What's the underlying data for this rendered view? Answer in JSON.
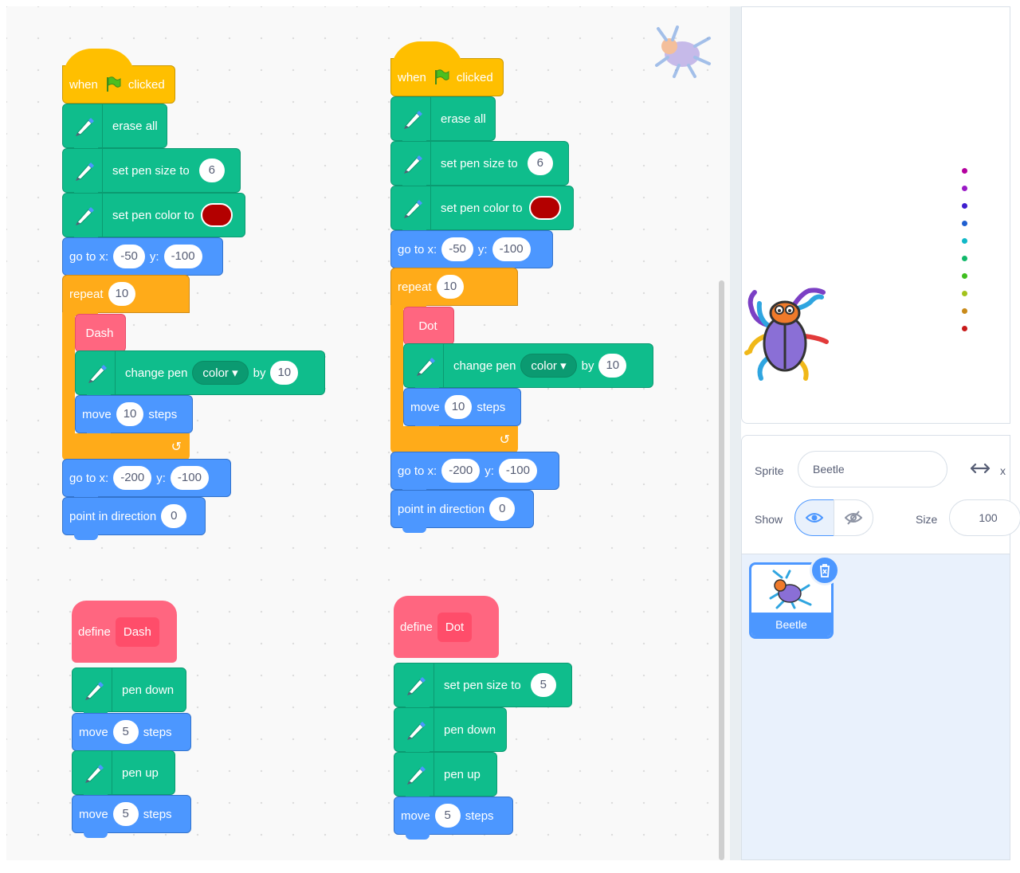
{
  "script1": {
    "hat": {
      "when": "when",
      "clicked": "clicked"
    },
    "erase": "erase all",
    "size": {
      "label": "set pen size to",
      "value": "6"
    },
    "color": {
      "label": "set pen color to"
    },
    "goto1": {
      "label": "go to x:",
      "x": "-50",
      "ylabel": "y:",
      "y": "-100"
    },
    "repeat": {
      "label": "repeat",
      "value": "10"
    },
    "call": "Dash",
    "change": {
      "label": "change pen",
      "dropdown": "color ▾",
      "by": "by",
      "value": "10"
    },
    "move": {
      "label": "move",
      "value": "10",
      "unit": "steps"
    },
    "loop_arrow": "↺",
    "goto2": {
      "label": "go to x:",
      "x": "-200",
      "ylabel": "y:",
      "y": "-100"
    },
    "point": {
      "label": "point in direction",
      "value": "0"
    }
  },
  "script2": {
    "hat": {
      "when": "when",
      "clicked": "clicked"
    },
    "erase": "erase all",
    "size": {
      "label": "set pen size to",
      "value": "6"
    },
    "color": {
      "label": "set pen color to"
    },
    "goto1": {
      "label": "go to x:",
      "x": "-50",
      "ylabel": "y:",
      "y": "-100"
    },
    "repeat": {
      "label": "repeat",
      "value": "10"
    },
    "call": "Dot",
    "change": {
      "label": "change pen",
      "dropdown": "color ▾",
      "by": "by",
      "value": "10"
    },
    "move": {
      "label": "move",
      "value": "10",
      "unit": "steps"
    },
    "loop_arrow": "↺",
    "goto2": {
      "label": "go to x:",
      "x": "-200",
      "ylabel": "y:",
      "y": "-100"
    },
    "point": {
      "label": "point in direction",
      "value": "0"
    }
  },
  "define_dash": {
    "define": "define",
    "name": "Dash",
    "pen_down": "pen down",
    "move1": {
      "label": "move",
      "value": "5",
      "unit": "steps"
    },
    "pen_up": "pen up",
    "move2": {
      "label": "move",
      "value": "5",
      "unit": "steps"
    }
  },
  "define_dot": {
    "define": "define",
    "name": "Dot",
    "size": {
      "label": "set pen size to",
      "value": "5"
    },
    "pen_down": "pen down",
    "pen_up": "pen up",
    "move": {
      "label": "move",
      "value": "5",
      "unit": "steps"
    }
  },
  "stage_dots": [
    "#b4009e",
    "#9a19c6",
    "#3f1fcf",
    "#1f5fd0",
    "#11b8c8",
    "#10b86a",
    "#3fbe1f",
    "#a3c21c",
    "#c98a1a",
    "#c81a1a"
  ],
  "sprite_info": {
    "sprite_label": "Sprite",
    "sprite_name": "Beetle",
    "x_label": "x",
    "show_label": "Show",
    "size_label": "Size",
    "size_value": "100"
  },
  "sprite_list": [
    {
      "name": "Beetle",
      "selected": true
    }
  ],
  "colors": {
    "pen": "#0fbd8c",
    "motion": "#4c97ff",
    "control": "#ffab19",
    "my_blocks": "#ff6680",
    "events": "#ffbf00",
    "pen_color_swatch": "#b30000"
  }
}
